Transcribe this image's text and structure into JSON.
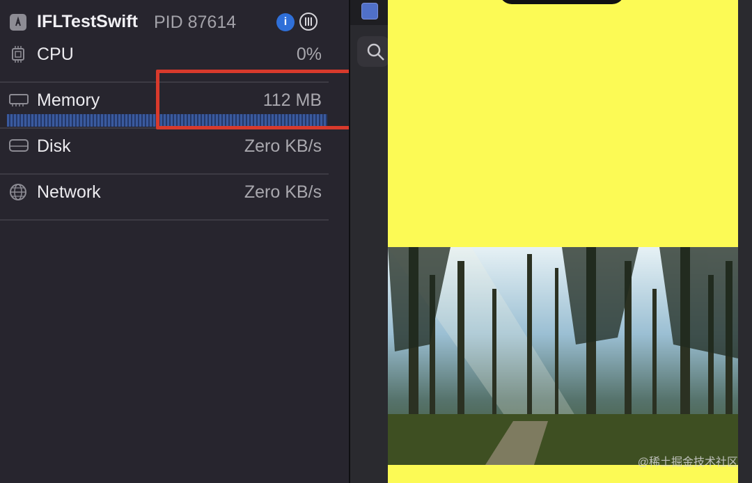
{
  "process": {
    "name": "IFLTestSwift",
    "pid_label": "PID 87614"
  },
  "gauges": [
    {
      "label": "CPU",
      "value": "0%"
    },
    {
      "label": "Memory",
      "value": "112 MB"
    },
    {
      "label": "Disk",
      "value": "Zero KB/s"
    },
    {
      "label": "Network",
      "value": "Zero KB/s"
    }
  ],
  "icons": {
    "app": "app-store-icon",
    "info": "info-icon",
    "threads": "threads-icon",
    "cpu": "cpu-chip-icon",
    "memory": "memory-icon",
    "disk": "disk-icon",
    "network": "globe-icon",
    "search": "search-icon"
  },
  "watermark": "@稀土掘金技术社区",
  "colors": {
    "highlight": "#d83a2c",
    "simulator_background": "#fcfa55",
    "memory_bar": "#3a5a9e",
    "info_button": "#2f6fd8"
  }
}
